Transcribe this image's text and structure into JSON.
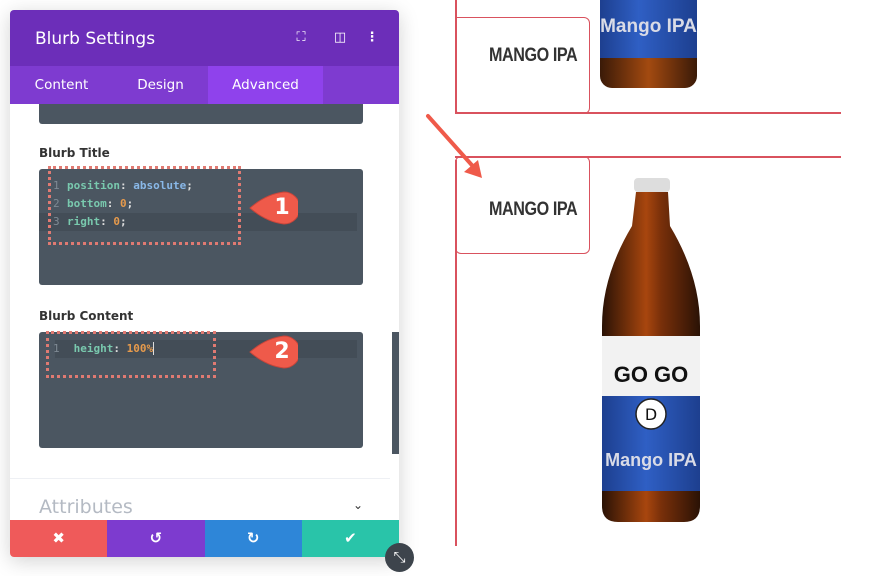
{
  "panel": {
    "title": "Blurb Settings",
    "header_icons": [
      "focus-icon",
      "split-view-icon",
      "more-vertical-icon"
    ],
    "tabs": [
      {
        "label": "Content"
      },
      {
        "label": "Design"
      },
      {
        "label": "Advanced",
        "active": true
      }
    ],
    "blurb_title": {
      "label": "Blurb Title",
      "lines": [
        {
          "n": "1",
          "prop": "position",
          "value": "absolute"
        },
        {
          "n": "2",
          "prop": "bottom",
          "value": "0"
        },
        {
          "n": "3",
          "prop": "right",
          "value": "0"
        }
      ]
    },
    "blurb_content": {
      "label": "Blurb Content",
      "lines": [
        {
          "n": "1",
          "prop": "height",
          "value": "100%"
        }
      ]
    },
    "attributes": {
      "label": "Attributes"
    },
    "footer": {
      "buttons": [
        "cancel",
        "undo",
        "redo",
        "save"
      ]
    }
  },
  "callouts": [
    "1",
    "2"
  ],
  "preview": {
    "items": [
      {
        "title": "MANGO IPA"
      },
      {
        "title": "MANGO IPA"
      }
    ],
    "bottle": {
      "brand": "GO GO",
      "logo": "D",
      "flavor": "Mango IPA"
    }
  },
  "colors": {
    "header": "#6c2eb9",
    "tabs": "#7e3bd0",
    "cancel": "#ef5a5a",
    "undo": "#7d3bcf",
    "redo": "#2e86d8",
    "save": "#29c4a9",
    "border": "#d9525e"
  }
}
